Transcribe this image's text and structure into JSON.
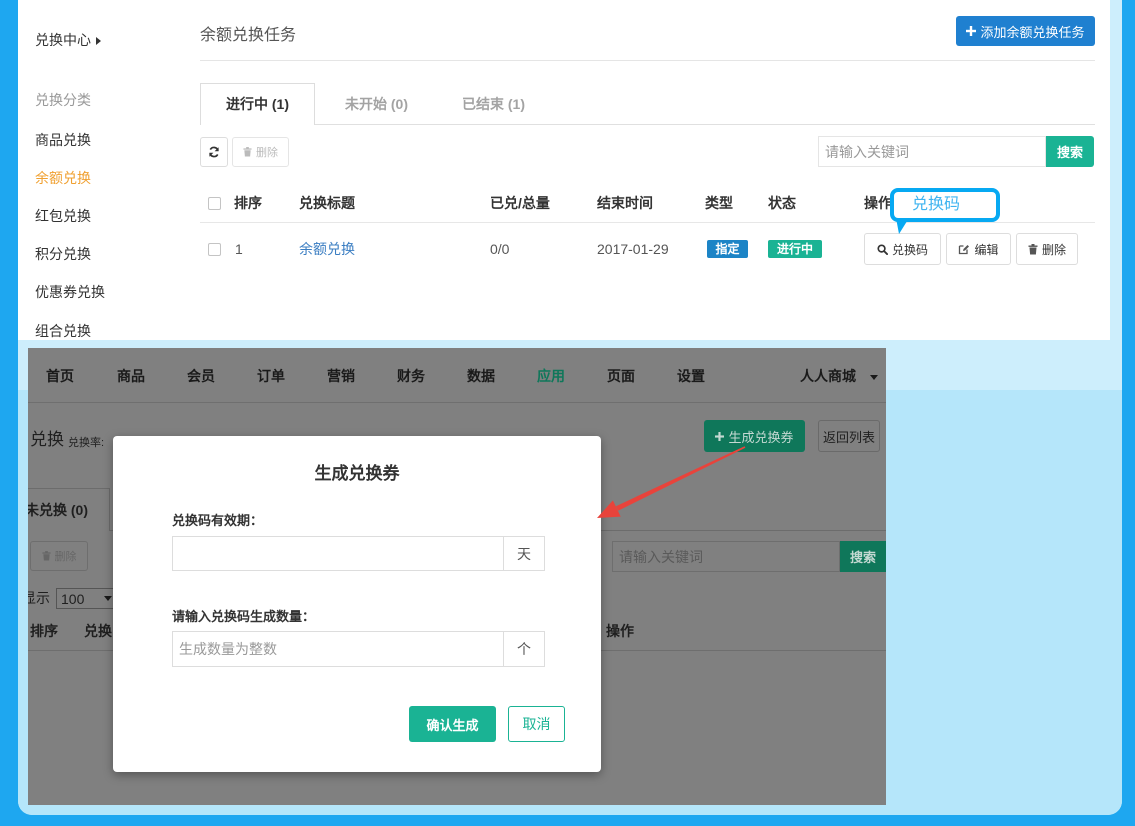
{
  "colors": {
    "frame_border": "#1ea7f0",
    "frame_fill": "#cdeefc",
    "frame_fill_lower": "#b5e6fa",
    "primary_blue": "#1f80d0",
    "success_green": "#1ab394",
    "badge_blue": "#1c84c6",
    "active_orange": "#f0a030",
    "link_blue": "#3a7dc2",
    "callout_blue": "#07a9f2",
    "arrow_red": "#e8433b",
    "overlay_gray": "#808080",
    "dim_green": "#0f775a"
  },
  "top": {
    "sidebar": {
      "title": "兑换中心",
      "section_label": "兑换分类",
      "items": [
        {
          "label": "商品兑换",
          "active": false
        },
        {
          "label": "余额兑换",
          "active": true
        },
        {
          "label": "红包兑换",
          "active": false
        },
        {
          "label": "积分兑换",
          "active": false
        },
        {
          "label": "优惠券兑换",
          "active": false
        },
        {
          "label": "组合兑换",
          "active": false
        }
      ]
    },
    "page_title": "余额兑换任务",
    "add_button": {
      "label": "添加余额兑换任务",
      "icon": "plus-icon"
    },
    "tabs": [
      {
        "label": "进行中 (1)",
        "active": true
      },
      {
        "label": "未开始 (0)",
        "active": false
      },
      {
        "label": "已结束 (1)",
        "active": false
      }
    ],
    "toolbar": {
      "refresh_icon": "refresh-icon",
      "delete_label": "删除",
      "delete_icon": "trash-icon",
      "search_placeholder": "请输入关键词",
      "search_button": "搜索"
    },
    "table": {
      "headers": [
        "排序",
        "兑换标题",
        "已兑/总量",
        "结束时间",
        "类型",
        "状态",
        "操作"
      ],
      "rows": [
        {
          "order": "1",
          "title": "余额兑换",
          "redeemed_total": "0/0",
          "end_time": "2017-01-29",
          "type": "指定",
          "status": "进行中",
          "actions": [
            {
              "label": "兑换码",
              "icon": "search-icon"
            },
            {
              "label": "编辑",
              "icon": "edit-icon"
            },
            {
              "label": "删除",
              "icon": "trash-icon"
            }
          ]
        }
      ]
    },
    "callout": {
      "text": "兑换码"
    }
  },
  "bottom": {
    "nav": {
      "items": [
        "首页",
        "商品",
        "会员",
        "订单",
        "营销",
        "财务",
        "数据",
        "应用",
        "页面",
        "设置"
      ],
      "active_index": 7,
      "shop_name": "人人商城"
    },
    "page_title": "兑换",
    "rate_label": "兑换率:",
    "generate_button": {
      "label": "生成兑换券",
      "icon": "plus-icon"
    },
    "back_button": "返回列表",
    "tab": "未兑换 (0)",
    "toolbar": {
      "delete_label": "删除",
      "search_placeholder": "请输入关键词",
      "search_button": "搜索"
    },
    "page_size": {
      "label": "显示",
      "value": "100"
    },
    "table_headers": [
      "排序",
      "兑换",
      "操作"
    ]
  },
  "modal": {
    "title": "生成兑换券",
    "validity_label": "兑换码有效期：",
    "validity_value": "",
    "validity_unit": "天",
    "count_label": "请输入兑换码生成数量：",
    "count_placeholder": "生成数量为整数",
    "count_unit": "个",
    "confirm_button": "确认生成",
    "cancel_button": "取消"
  }
}
